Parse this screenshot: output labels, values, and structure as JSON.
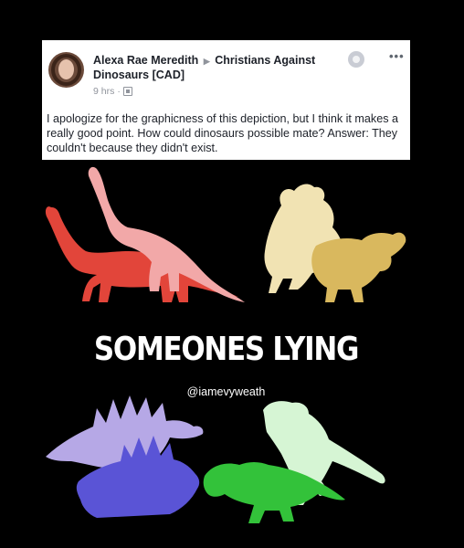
{
  "post": {
    "author": "Alexa Rae Meredith",
    "group": "Christians Against Dinosaurs [CAD]",
    "time": "9 hrs",
    "body": "I apologize for the graphicness of this depiction, but I think it makes a really good point. How could dinosaurs possible mate? Answer: They couldn't because they didn't exist.",
    "more_icon": "ellipsis-icon",
    "badge_icon": "group-badge-icon",
    "privacy_icon": "public-icon"
  },
  "meme": {
    "caption": "SOMEONES LYING",
    "handle": "@iamevyweath",
    "background": "#000000",
    "colors": {
      "brachio_red": "#e2453a",
      "brachio_pink": "#f2a8a8",
      "trike_cream": "#f1e3b3",
      "trike_gold": "#d9b85e",
      "stego_lavender": "#b6a8e6",
      "stego_blue": "#5a54d6",
      "trex_mint": "#d6f5d4",
      "trex_green": "#33c23a"
    }
  }
}
